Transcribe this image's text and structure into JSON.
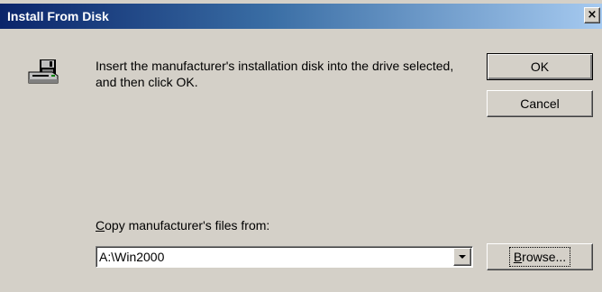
{
  "window": {
    "title": "Install From Disk",
    "close_glyph": "×"
  },
  "icon": "floppy-disk-drive-icon",
  "message": "Insert the manufacturer's installation disk into the drive selected, and then click OK.",
  "buttons": {
    "ok": "OK",
    "cancel": "Cancel",
    "browse_prefix": "",
    "browse_accel": "B",
    "browse_rest": "rowse..."
  },
  "copy_from": {
    "label_accel": "C",
    "label_rest": "opy manufacturer's files from:",
    "value": "A:\\Win2000"
  },
  "colors": {
    "title_start": "#0a246a",
    "title_end": "#a6caf0",
    "face": "#d4d0c8"
  }
}
